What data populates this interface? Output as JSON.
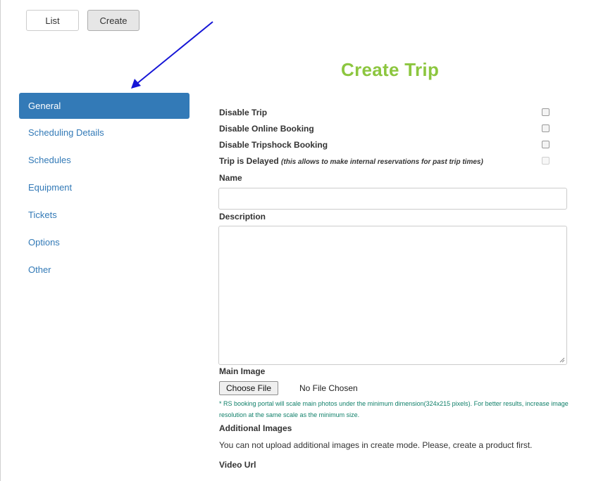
{
  "top_tabs": {
    "list_label": "List",
    "create_label": "Create"
  },
  "page": {
    "title": "Create Trip"
  },
  "sidebar": {
    "items": [
      {
        "label": "General",
        "active": true
      },
      {
        "label": "Scheduling Details"
      },
      {
        "label": "Schedules"
      },
      {
        "label": "Equipment"
      },
      {
        "label": "Tickets"
      },
      {
        "label": "Options"
      },
      {
        "label": "Other"
      }
    ]
  },
  "form": {
    "checkboxes": [
      {
        "label": "Disable Trip",
        "checked": false
      },
      {
        "label": "Disable Online Booking",
        "checked": false
      },
      {
        "label": "Disable Tripshock Booking",
        "checked": false
      },
      {
        "label": "Trip is Delayed",
        "note": "(this allows to make internal reservations for past trip times)",
        "checked": false,
        "disabled": true
      }
    ],
    "name_label": "Name",
    "name_value": "",
    "description_label": "Description",
    "description_value": "",
    "main_image_label": "Main Image",
    "choose_file_label": "Choose File",
    "file_status": "No File Chosen",
    "image_hint": "* RS booking portal will scale main photos under the minimum dimension(324x215 pixels). For better results, increase image resolution at the same scale as the minimum size.",
    "additional_images_label": "Additional Images",
    "additional_images_text": "You can not upload additional images in create mode. Please, create a product first.",
    "video_url_label": "Video Url"
  },
  "colors": {
    "accent": "#337ab7",
    "title_green": "#8cc63f",
    "hint_green": "#11806a",
    "arrow": "#1515d6"
  }
}
